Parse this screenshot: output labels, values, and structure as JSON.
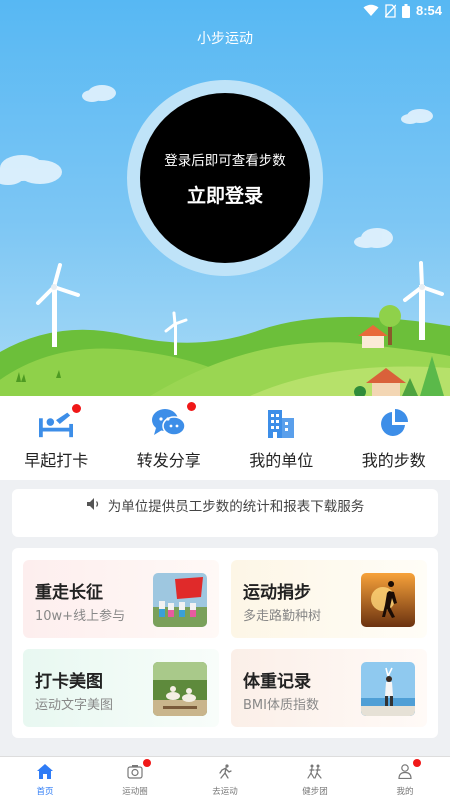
{
  "status_bar": {
    "time": "8:54",
    "icons": [
      "wifi-icon",
      "no-sim-icon",
      "battery-icon"
    ]
  },
  "header": {
    "title": "小步运动"
  },
  "login": {
    "hint": "登录后即可查看步数",
    "button_label": "立即登录"
  },
  "shortcuts": [
    {
      "label": "早起打卡",
      "icon": "bed-icon",
      "badge": true
    },
    {
      "label": "转发分享",
      "icon": "chat-icon",
      "badge": true
    },
    {
      "label": "我的单位",
      "icon": "building-icon",
      "badge": false
    },
    {
      "label": "我的步数",
      "icon": "pie-chart-icon",
      "badge": false
    }
  ],
  "notice": {
    "icon": "speaker-icon",
    "text": "为单位提供员工步数的统计和报表下载服务"
  },
  "features": [
    {
      "title": "重走长征",
      "subtitle": "10w+线上参与",
      "thumb": "flag-team-photo"
    },
    {
      "title": "运动捐步",
      "subtitle": "多走路勤种树",
      "thumb": "runner-sunset-photo"
    },
    {
      "title": "打卡美图",
      "subtitle": "运动文字美图",
      "thumb": "park-yoga-photo"
    },
    {
      "title": "体重记录",
      "subtitle": "BMI体质指数",
      "thumb": "seaside-stretch-photo"
    }
  ],
  "tabbar": [
    {
      "label": "首页",
      "icon": "home-icon",
      "active": true,
      "badge": false
    },
    {
      "label": "运动圈",
      "icon": "camera-icon",
      "active": false,
      "badge": true
    },
    {
      "label": "去运动",
      "icon": "run-icon",
      "active": false,
      "badge": false
    },
    {
      "label": "健步团",
      "icon": "group-run-icon",
      "active": false,
      "badge": false
    },
    {
      "label": "我的",
      "icon": "person-icon",
      "active": false,
      "badge": true
    }
  ],
  "colors": {
    "accent": "#2f7cf6",
    "icon_blue": "#3d8ee8",
    "badge_red": "#f01818",
    "sky": "#57b8f3",
    "grass": "#7cc234"
  }
}
